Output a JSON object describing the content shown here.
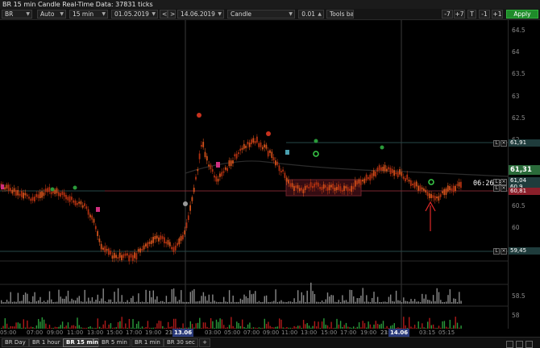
{
  "window": {
    "title": "BR 15 min Candle Real-Time Data: 37831 ticks"
  },
  "toolbar": {
    "symbol": "BR",
    "mode": "Auto",
    "interval": "15 min",
    "date_from": "01.05.2019",
    "nav_prev": "<",
    "nav_next": ">",
    "date_to": "14.06.2019",
    "chart_type": "Candle",
    "step_value": "0.01",
    "tools_bar_label": "Tools bar",
    "zoom_buttons": [
      "-7",
      "+7",
      "T",
      "-1",
      "+1"
    ],
    "apply_label": "Apply"
  },
  "price_scale": {
    "labels": [
      "64.5",
      "64",
      "63.5",
      "63",
      "62.5",
      "62",
      "61.5",
      "61",
      "60.5",
      "60"
    ],
    "volume_labels": [
      "58.5",
      "58"
    ],
    "markers": [
      {
        "text": "61,91",
        "color": "#1f3c3c"
      },
      {
        "text": "61,31",
        "color": "#2a6b3a"
      },
      {
        "text": "61,04",
        "color": "#1f3c3c"
      },
      {
        "text": "60,9",
        "color": "#1f3c3c"
      },
      {
        "text": "60,81",
        "color": "#8a1f2a"
      },
      {
        "text": "59,45",
        "color": "#1f3c3c"
      }
    ]
  },
  "timer": "06:26:33",
  "time_axis": {
    "ticks": [
      "05:00",
      "07:00",
      "09:00",
      "11:00",
      "13:00",
      "15:00",
      "17:00",
      "19:00",
      "21:00",
      "23",
      "13.06",
      "03:00",
      "05:00",
      "07:00",
      "09:00",
      "11:00",
      "13:00",
      "15:00",
      "17:00",
      "19:00",
      "21:00",
      "23",
      "14.06",
      "03:15",
      "05:15"
    ]
  },
  "bottom_tabs": [
    "BR Day",
    "BR 1 hour",
    "BR 15 min",
    "BR 5 min",
    "BR 1 min",
    "BR 30 sec",
    "+"
  ],
  "active_tab": "BR 15 min",
  "colors": {
    "up_candle": "#d0501a",
    "down_candle": "#b03010",
    "volume": "#a0a0a0",
    "delta_up": "#2a9a3a",
    "delta_down": "#b01a1a",
    "accent_apply": "#1f8b2a"
  }
}
